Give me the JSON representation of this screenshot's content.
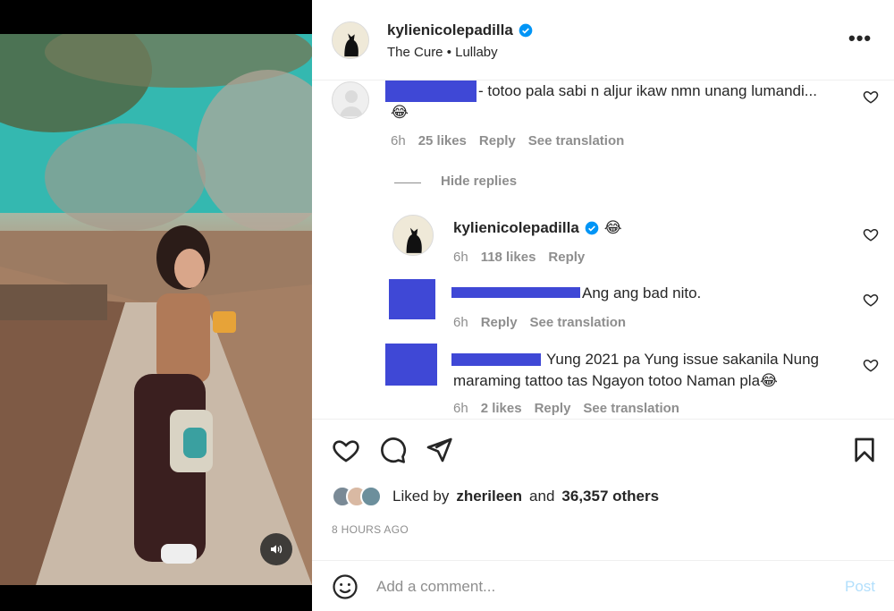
{
  "post": {
    "username": "kylienicolepadilla",
    "audio": "The Cure • Lullaby",
    "more_label": "•••"
  },
  "comments": [
    {
      "text": "- totoo pala sabi n aljur ikaw nmn unang lumandi...",
      "emoji": "😂",
      "time": "6h",
      "likes": "25 likes",
      "reply": "Reply",
      "translate": "See translation"
    }
  ],
  "hide_replies": "Hide replies",
  "replies": [
    {
      "username": "kylienicolepadilla",
      "emoji": "😂",
      "time": "6h",
      "likes": "118 likes",
      "reply": "Reply"
    },
    {
      "text": "Ang ang bad nito.",
      "time": "6h",
      "reply": "Reply",
      "translate": "See translation"
    },
    {
      "text_line1": "Yung 2021 pa Yung issue sakanila Nung",
      "text_line2": "maraming tattoo tas Ngayon totoo Naman pla😂",
      "time": "6h",
      "likes": "2 likes",
      "reply": "Reply",
      "translate": "See translation"
    }
  ],
  "likes": {
    "prefix": "Liked by",
    "user": "zherileen",
    "and": "and",
    "others": "36,357 others"
  },
  "time_ago": "8 HOURS AGO",
  "comment_box": {
    "placeholder": "Add a comment...",
    "post_label": "Post"
  },
  "colors": {
    "redaction": "#3f48d6",
    "verified": "#0095f6",
    "post_disabled": "#b2dffc"
  }
}
